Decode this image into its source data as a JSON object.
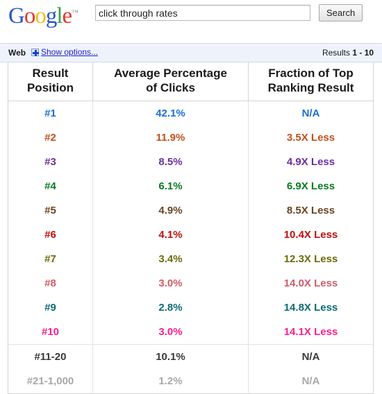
{
  "branding": {
    "logo_letters": [
      {
        "char": "G",
        "color": "#2a55c4"
      },
      {
        "char": "o",
        "color": "#e8342a"
      },
      {
        "char": "o",
        "color": "#f5bc12"
      },
      {
        "char": "g",
        "color": "#2a55c4"
      },
      {
        "char": "l",
        "color": "#33a14c"
      },
      {
        "char": "e",
        "color": "#e8342a"
      }
    ],
    "trademark": "™"
  },
  "search": {
    "value": "click through rates",
    "placeholder": "",
    "button_label": "Search"
  },
  "navbar": {
    "web_tab": "Web",
    "show_options_label": "Show options...",
    "show_options_icon": "plus-box-icon",
    "results_prefix": "Results",
    "results_range": "1 - 10"
  },
  "table": {
    "headers": [
      "Result\nPosition",
      "Average Percentage\nof Clicks",
      "Fraction of Top\nRanking Result"
    ],
    "headers_lines": [
      [
        "Result",
        "Position"
      ],
      [
        "Average Percentage",
        "of Clicks"
      ],
      [
        "Fraction of Top",
        "Ranking Result"
      ]
    ],
    "rows": [
      {
        "position": "#1",
        "percentage": "42.1%",
        "fraction": "N/A",
        "color": "#1a6fd4"
      },
      {
        "position": "#2",
        "percentage": "11.9%",
        "fraction": "3.5X Less",
        "color": "#c1501d"
      },
      {
        "position": "#3",
        "percentage": "8.5%",
        "fraction": "4.9X Less",
        "color": "#6b2e9e"
      },
      {
        "position": "#4",
        "percentage": "6.1%",
        "fraction": "6.9X Less",
        "color": "#0a7a20"
      },
      {
        "position": "#5",
        "percentage": "4.9%",
        "fraction": "8.5X Less",
        "color": "#6b4420"
      },
      {
        "position": "#6",
        "percentage": "4.1%",
        "fraction": "10.4X Less",
        "color": "#c20d0d"
      },
      {
        "position": "#7",
        "percentage": "3.4%",
        "fraction": "12.3X Less",
        "color": "#6b6b0a"
      },
      {
        "position": "#8",
        "percentage": "3.0%",
        "fraction": "14.0X Less",
        "color": "#cf5c68"
      },
      {
        "position": "#9",
        "percentage": "2.8%",
        "fraction": "14.8X Less",
        "color": "#0d6b73"
      },
      {
        "position": "#10",
        "percentage": "3.0%",
        "fraction": "14.1X Less",
        "color": "#fa1e8c"
      },
      {
        "position": "#11-20",
        "percentage": "10.1%",
        "fraction": "N/A",
        "color": "#3a3a3a",
        "separator_above": true
      },
      {
        "position": "#21-1,000",
        "percentage": "1.2%",
        "fraction": "N/A",
        "color": "#a8a8a8"
      }
    ]
  },
  "chart_data": {
    "type": "table",
    "title": "Click through rates by Google result position",
    "columns": [
      "Result Position",
      "Average Percentage of Clicks",
      "Fraction of Top Ranking Result"
    ],
    "categories": [
      "#1",
      "#2",
      "#3",
      "#4",
      "#5",
      "#6",
      "#7",
      "#8",
      "#9",
      "#10",
      "#11-20",
      "#21-1,000"
    ],
    "series": [
      {
        "name": "Average Percentage of Clicks",
        "unit": "%",
        "values": [
          42.1,
          11.9,
          8.5,
          6.1,
          4.9,
          4.1,
          3.4,
          3.0,
          2.8,
          3.0,
          10.1,
          1.2
        ]
      },
      {
        "name": "Fraction of Top Ranking Result",
        "unit": "X Less",
        "values": [
          null,
          3.5,
          4.9,
          6.9,
          8.5,
          10.4,
          12.3,
          14.0,
          14.8,
          14.1,
          null,
          null
        ],
        "null_label": "N/A"
      }
    ],
    "xlabel": "Result Position",
    "ylabel": "Average Percentage of Clicks",
    "ylim": [
      0,
      45
    ],
    "grid": false,
    "legend": "none"
  }
}
